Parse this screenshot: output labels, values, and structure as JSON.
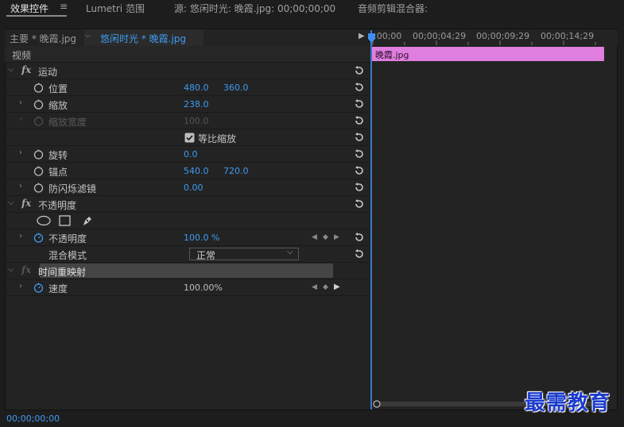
{
  "tabs": {
    "effect_controls": "效果控件",
    "lumetri": "Lumetri 范围",
    "source": "源: 悠闲时光: 晚霞.jpg: 00;00;00;00",
    "audio_mixer": "音频剪辑混合器:"
  },
  "sequence": {
    "master": "主要 * 晚霞.jpg",
    "active": "悠闲时光 * 晚霞.jpg"
  },
  "ruler": {
    "labels": [
      ":00;00",
      "00;00;04;29",
      "00;00;09;29",
      "00;00;14;29"
    ]
  },
  "clip": {
    "label": "晚霞.jpg"
  },
  "sections": {
    "video": "视频",
    "motion": "运动",
    "opacity_section": "不透明度",
    "time_remap": "时间重映射",
    "fx": "fx"
  },
  "properties": {
    "position": {
      "label": "位置",
      "x": "480.0",
      "y": "360.0"
    },
    "scale": {
      "label": "缩放",
      "value": "238.0"
    },
    "scale_width": {
      "label": "缩放宽度",
      "value": "100.0"
    },
    "uniform_scale": {
      "label": "等比缩放"
    },
    "rotation": {
      "label": "旋转",
      "value": "0.0"
    },
    "anchor": {
      "label": "锚点",
      "x": "540.0",
      "y": "720.0"
    },
    "antiflicker": {
      "label": "防闪烁滤镜",
      "value": "0.00"
    },
    "opacity": {
      "label": "不透明度",
      "value": "100.0 %"
    },
    "blend_mode": {
      "label": "混合模式",
      "value": "正常"
    },
    "speed": {
      "label": "速度",
      "value": "100.00%"
    }
  },
  "footer": {
    "timecode": "00;00;00;00"
  },
  "watermark": "最需教育",
  "colors": {
    "accent": "#3f9bf0",
    "clip": "#e07ee0",
    "playhead": "#3a76c4"
  }
}
